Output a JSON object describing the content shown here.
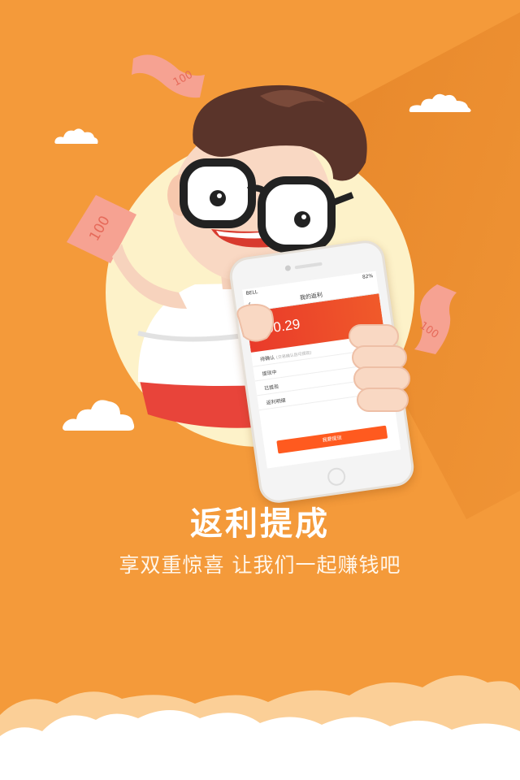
{
  "colors": {
    "background": "#f49a3a",
    "sun": "#fdf2c9",
    "accent_red": "#e93a2a",
    "button": "#ff5a1f",
    "white": "#ffffff"
  },
  "phone": {
    "status": {
      "carrier": "BELL",
      "battery": "82%"
    },
    "nav": {
      "title": "我的返利",
      "back_icon": "chevron-left-icon"
    },
    "balance": ",000.29",
    "menu": [
      {
        "label": "待确认",
        "hint": "(交易确认后可提现)"
      },
      {
        "label": "提现中",
        "hint": ""
      },
      {
        "label": "已提现",
        "hint": ""
      },
      {
        "label": "返利明细",
        "hint": ""
      }
    ],
    "withdraw_button": "我要提现"
  },
  "bills": [
    "100",
    "100",
    "100"
  ],
  "headline": {
    "title": "返利提成",
    "subtitle": "享双重惊喜  让我们一起赚钱吧"
  }
}
